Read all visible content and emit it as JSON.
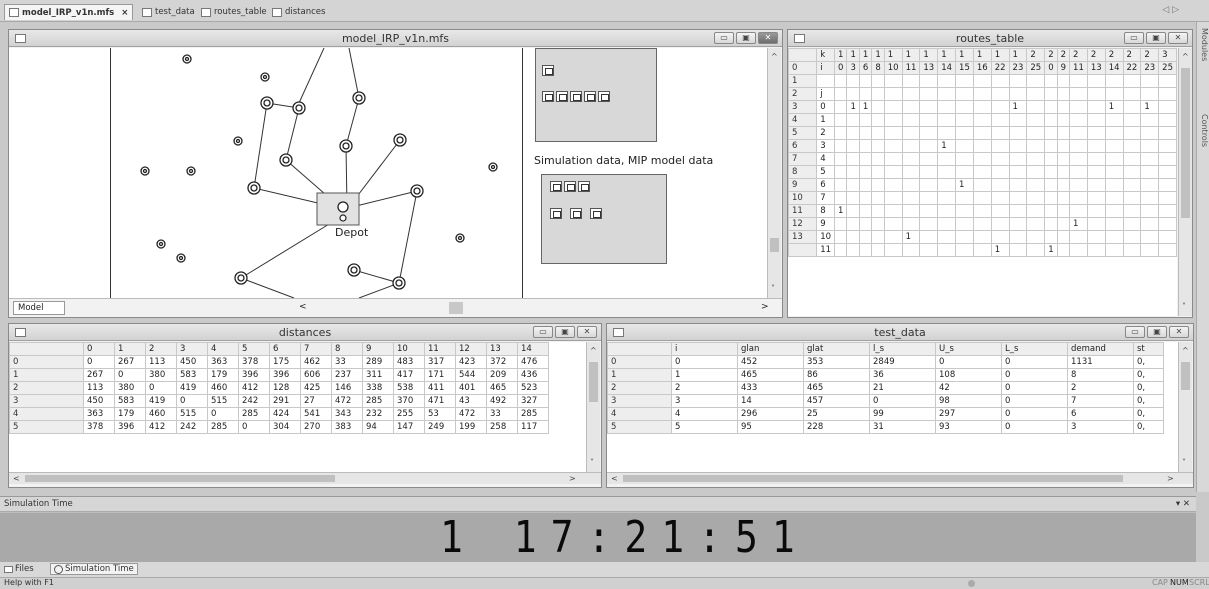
{
  "tabs": [
    "model_IRP_v1n.mfs",
    "test_data",
    "routes_table",
    "distances"
  ],
  "tab_close": "×",
  "nav_arrows": "◁ ▷",
  "side_panels": [
    "Modules",
    "Controls"
  ],
  "model_window": {
    "title": "model_IRP_v1n.mfs",
    "depot_label": "Depot",
    "sim_label": "Simulation data, MIP model data",
    "bottom_tab": "Model",
    "scroll_left": "<",
    "scroll_right": ">"
  },
  "routes_table": {
    "title": "routes_table",
    "header_k": [
      "k",
      "1",
      "1",
      "1",
      "1",
      "1",
      "1",
      "1",
      "1",
      "1",
      "1",
      "1",
      "1",
      "2",
      "2",
      "2",
      "2",
      "2",
      "2",
      "2",
      "2",
      "3"
    ],
    "header_i": [
      "i",
      "0",
      "3",
      "6",
      "8",
      "10",
      "11",
      "13",
      "14",
      "15",
      "16",
      "22",
      "23",
      "25",
      "0",
      "9",
      "11",
      "13",
      "14",
      "22",
      "23",
      "25"
    ],
    "row_labels": [
      "0",
      "1",
      "2",
      "3",
      "4",
      "5",
      "6",
      "7",
      "8",
      "9",
      "10",
      "11",
      "12",
      "13"
    ],
    "rows": [
      [
        "",
        "",
        "",
        "",
        "",
        "",
        "",
        "",
        "",
        "",
        "",
        "",
        "",
        "",
        "",
        "",
        "",
        "",
        "",
        "",
        "",
        ""
      ],
      [
        "j",
        "",
        "",
        "",
        "",
        "",
        "",
        "",
        "",
        "",
        "",
        "",
        "",
        "",
        "",
        "",
        "",
        "",
        "",
        "",
        "",
        ""
      ],
      [
        "0",
        "",
        "1",
        "1",
        "",
        "",
        "",
        "",
        "",
        "",
        "",
        "",
        "1",
        "",
        "",
        "",
        "",
        "",
        "1",
        "",
        "1",
        ""
      ],
      [
        "1",
        "",
        "",
        "",
        "",
        "",
        "",
        "",
        "",
        "",
        "",
        "",
        "",
        "",
        "",
        "",
        "",
        "",
        "",
        "",
        "",
        ""
      ],
      [
        "2",
        "",
        "",
        "",
        "",
        "",
        "",
        "",
        "",
        "",
        "",
        "",
        "",
        "",
        "",
        "",
        "",
        "",
        "",
        "",
        "",
        ""
      ],
      [
        "3",
        "",
        "",
        "",
        "",
        "",
        "",
        "",
        "1",
        "",
        "",
        "",
        "",
        "",
        "",
        "",
        "",
        "",
        "",
        "",
        "",
        ""
      ],
      [
        "4",
        "",
        "",
        "",
        "",
        "",
        "",
        "",
        "",
        "",
        "",
        "",
        "",
        "",
        "",
        "",
        "",
        "",
        "",
        "",
        "",
        ""
      ],
      [
        "5",
        "",
        "",
        "",
        "",
        "",
        "",
        "",
        "",
        "",
        "",
        "",
        "",
        "",
        "",
        "",
        "",
        "",
        "",
        "",
        "",
        ""
      ],
      [
        "6",
        "",
        "",
        "",
        "",
        "",
        "",
        "",
        "",
        "1",
        "",
        "",
        "",
        "",
        "",
        "",
        "",
        "",
        "",
        "",
        "",
        ""
      ],
      [
        "7",
        "",
        "",
        "",
        "",
        "",
        "",
        "",
        "",
        "",
        "",
        "",
        "",
        "",
        "",
        "",
        "",
        "",
        "",
        "",
        "",
        ""
      ],
      [
        "8",
        "1",
        "",
        "",
        "",
        "",
        "",
        "",
        "",
        "",
        "",
        "",
        "",
        "",
        "",
        "",
        "",
        "",
        "",
        "",
        "",
        ""
      ],
      [
        "9",
        "",
        "",
        "",
        "",
        "",
        "",
        "",
        "",
        "",
        "",
        "",
        "",
        "",
        "",
        "",
        "1",
        "",
        "",
        "",
        "",
        ""
      ],
      [
        "10",
        "",
        "",
        "",
        "",
        "",
        "1",
        "",
        "",
        "",
        "",
        "",
        "",
        "",
        "",
        "",
        "",
        "",
        "",
        "",
        "",
        ""
      ],
      [
        "11",
        "",
        "",
        "",
        "",
        "",
        "",
        "",
        "",
        "",
        "",
        "1",
        "",
        "",
        "1",
        "",
        "",
        "",
        "",
        "",
        "",
        ""
      ]
    ]
  },
  "distances": {
    "title": "distances",
    "columns": [
      "",
      "0",
      "1",
      "2",
      "3",
      "4",
      "5",
      "6",
      "7",
      "8",
      "9",
      "10",
      "11",
      "12",
      "13",
      "14"
    ],
    "rows": [
      [
        "0",
        "0",
        "267",
        "113",
        "450",
        "363",
        "378",
        "175",
        "462",
        "33",
        "289",
        "483",
        "317",
        "423",
        "372",
        "476"
      ],
      [
        "1",
        "267",
        "0",
        "380",
        "583",
        "179",
        "396",
        "396",
        "606",
        "237",
        "311",
        "417",
        "171",
        "544",
        "209",
        "436"
      ],
      [
        "2",
        "113",
        "380",
        "0",
        "419",
        "460",
        "412",
        "128",
        "425",
        "146",
        "338",
        "538",
        "411",
        "401",
        "465",
        "523"
      ],
      [
        "3",
        "450",
        "583",
        "419",
        "0",
        "515",
        "242",
        "291",
        "27",
        "472",
        "285",
        "370",
        "471",
        "43",
        "492",
        "327"
      ],
      [
        "4",
        "363",
        "179",
        "460",
        "515",
        "0",
        "285",
        "424",
        "541",
        "343",
        "232",
        "255",
        "53",
        "472",
        "33",
        "285"
      ],
      [
        "5",
        "378",
        "396",
        "412",
        "242",
        "285",
        "0",
        "304",
        "270",
        "383",
        "94",
        "147",
        "249",
        "199",
        "258",
        "117"
      ]
    ]
  },
  "test_data": {
    "title": "test_data",
    "columns": [
      "",
      "i",
      "glan",
      "glat",
      "l_s",
      "U_s",
      "L_s",
      "demand",
      "st"
    ],
    "rows": [
      [
        "0",
        "0",
        "452",
        "353",
        "2849",
        "0",
        "0",
        "1131",
        "0,"
      ],
      [
        "1",
        "1",
        "465",
        "86",
        "36",
        "108",
        "0",
        "8",
        "0,"
      ],
      [
        "2",
        "2",
        "433",
        "465",
        "21",
        "42",
        "0",
        "2",
        "0,"
      ],
      [
        "3",
        "3",
        "14",
        "457",
        "0",
        "98",
        "0",
        "7",
        "0,"
      ],
      [
        "4",
        "4",
        "296",
        "25",
        "99",
        "297",
        "0",
        "6",
        "0,"
      ],
      [
        "5",
        "5",
        "95",
        "228",
        "31",
        "93",
        "0",
        "3",
        "0,"
      ]
    ]
  },
  "simulation_time": {
    "title": "Simulation Time",
    "clock": "1 17:21:51",
    "pin": "▾ ✕"
  },
  "bottom_tabs": [
    "Files",
    "Simulation Time"
  ],
  "status": {
    "help": "Help with F1",
    "indicators": [
      "CAP",
      "NUM",
      "SCRL"
    ]
  }
}
